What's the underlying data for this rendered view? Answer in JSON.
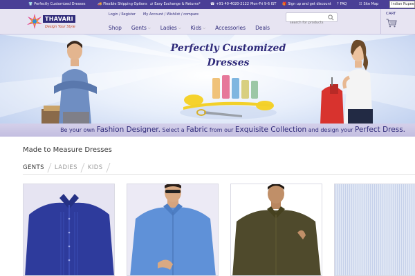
{
  "topbar": {
    "items": [
      {
        "icon": "shirt-icon",
        "label": "Perfectly Customized Dresses"
      },
      {
        "icon": "truck-icon",
        "label": "Flexible Shipping Options"
      },
      {
        "icon": "exchange-icon",
        "label": "Easy Exchange & Returns*"
      },
      {
        "icon": "phone-icon",
        "label": "+91-40-4020-2122",
        "detail": "Mon-Fri 9-6 IST"
      },
      {
        "icon": "gift-icon",
        "label": "Sign up and get discount"
      },
      {
        "icon": "help-icon",
        "label": "FAQ"
      },
      {
        "icon": "sitemap-icon",
        "label": "Site Map"
      }
    ],
    "currency": "Indian Rupee"
  },
  "header": {
    "brand": "THAVARI",
    "tagline": "Design Your Style",
    "login": "Login",
    "register": "Register",
    "account_links": "My Account / Wishlist / compare",
    "search_placeholder": "search for products",
    "cart_label": "CART",
    "nav": [
      {
        "label": "Shop",
        "has_dropdown": false
      },
      {
        "label": "Gents",
        "has_dropdown": true
      },
      {
        "label": "Ladies",
        "has_dropdown": true
      },
      {
        "label": "Kids",
        "has_dropdown": true
      },
      {
        "label": "Accessories",
        "has_dropdown": false
      },
      {
        "label": "Deals",
        "has_dropdown": false
      }
    ]
  },
  "banner": {
    "title_line1": "Perfectly Customized",
    "title_line2": "Dresses",
    "tagline": {
      "t1": "Be your own ",
      "b1": "Fashion Designer.",
      "t2": " Select a ",
      "b2": "Fabric",
      "t3": " from our ",
      "b3": "Exquisite Collection",
      "t4": " and design your ",
      "b4": "Perfect Dress."
    }
  },
  "section": {
    "title": "Made to Measure Dresses",
    "tabs": [
      {
        "label": "GENTS",
        "active": true
      },
      {
        "label": "LADIES",
        "active": false
      },
      {
        "label": "KIDS",
        "active": false
      }
    ]
  },
  "colors": {
    "brand_purple": "#4a3f96",
    "nav_text": "#2f2a7a",
    "header_bg": "#e7e4f2"
  }
}
